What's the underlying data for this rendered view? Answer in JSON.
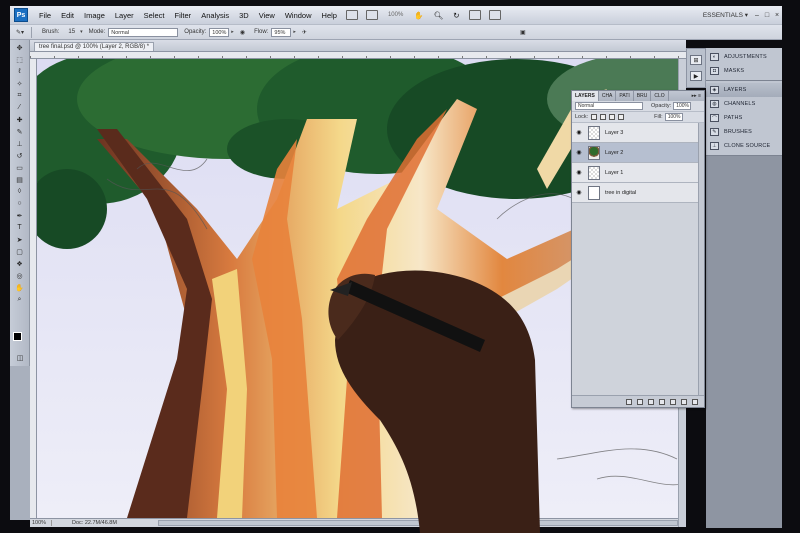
{
  "app": {
    "logo": "Ps",
    "workspace": "ESSENTIALS ▾",
    "zoom_readout": "100%"
  },
  "menus": [
    "File",
    "Edit",
    "Image",
    "Layer",
    "Select",
    "Filter",
    "Analysis",
    "3D",
    "View",
    "Window",
    "Help"
  ],
  "options": {
    "brush_label": "Brush:",
    "brush_size": "15",
    "mode_label": "Mode:",
    "mode_value": "Normal",
    "opacity_label": "Opacity:",
    "opacity_value": "100%",
    "flow_label": "Flow:",
    "flow_value": "95%"
  },
  "document": {
    "tab_title": "tree final.psd @ 100% (Layer 2, RGB/8) *",
    "status_zoom": "100%",
    "status_doc": "Doc: 22.7M/46.8M"
  },
  "dock": {
    "group1": [
      {
        "label": "ADJUSTMENTS",
        "icon": "adjustments-icon"
      },
      {
        "label": "MASKS",
        "icon": "masks-icon"
      }
    ],
    "group2": [
      {
        "label": "LAYERS",
        "icon": "layers-icon"
      },
      {
        "label": "CHANNELS",
        "icon": "channels-icon"
      },
      {
        "label": "PATHS",
        "icon": "paths-icon"
      },
      {
        "label": "BRUSHES",
        "icon": "brushes-icon"
      },
      {
        "label": "CLONE SOURCE",
        "icon": "clone-source-icon"
      }
    ]
  },
  "layers_panel": {
    "tabs": [
      "LAYERS",
      "CHA",
      "PATI",
      "BRU",
      "CLO"
    ],
    "menu_glyph": "▸▸ ≡",
    "blend_mode": "Normal",
    "opacity_label": "Opacity:",
    "opacity_value": "100%",
    "lock_label": "Lock:",
    "fill_label": "Fill:",
    "fill_value": "100%",
    "layers": [
      {
        "name": "Layer 3",
        "thumb": "transparent",
        "selected": false
      },
      {
        "name": "Layer 2",
        "thumb": "tree",
        "selected": true
      },
      {
        "name": "Layer 1",
        "thumb": "transparent",
        "selected": false
      },
      {
        "name": "tree in digital",
        "thumb": "blank",
        "selected": false
      }
    ]
  },
  "colors": {
    "canvas_bg": "#e9e9f7",
    "foliage": "#1f5b2c",
    "trunk_orange": "#e07a3a",
    "trunk_yellow": "#f2d27a",
    "trunk_dark": "#5a2b1c",
    "selection": "#b6bfd0"
  }
}
